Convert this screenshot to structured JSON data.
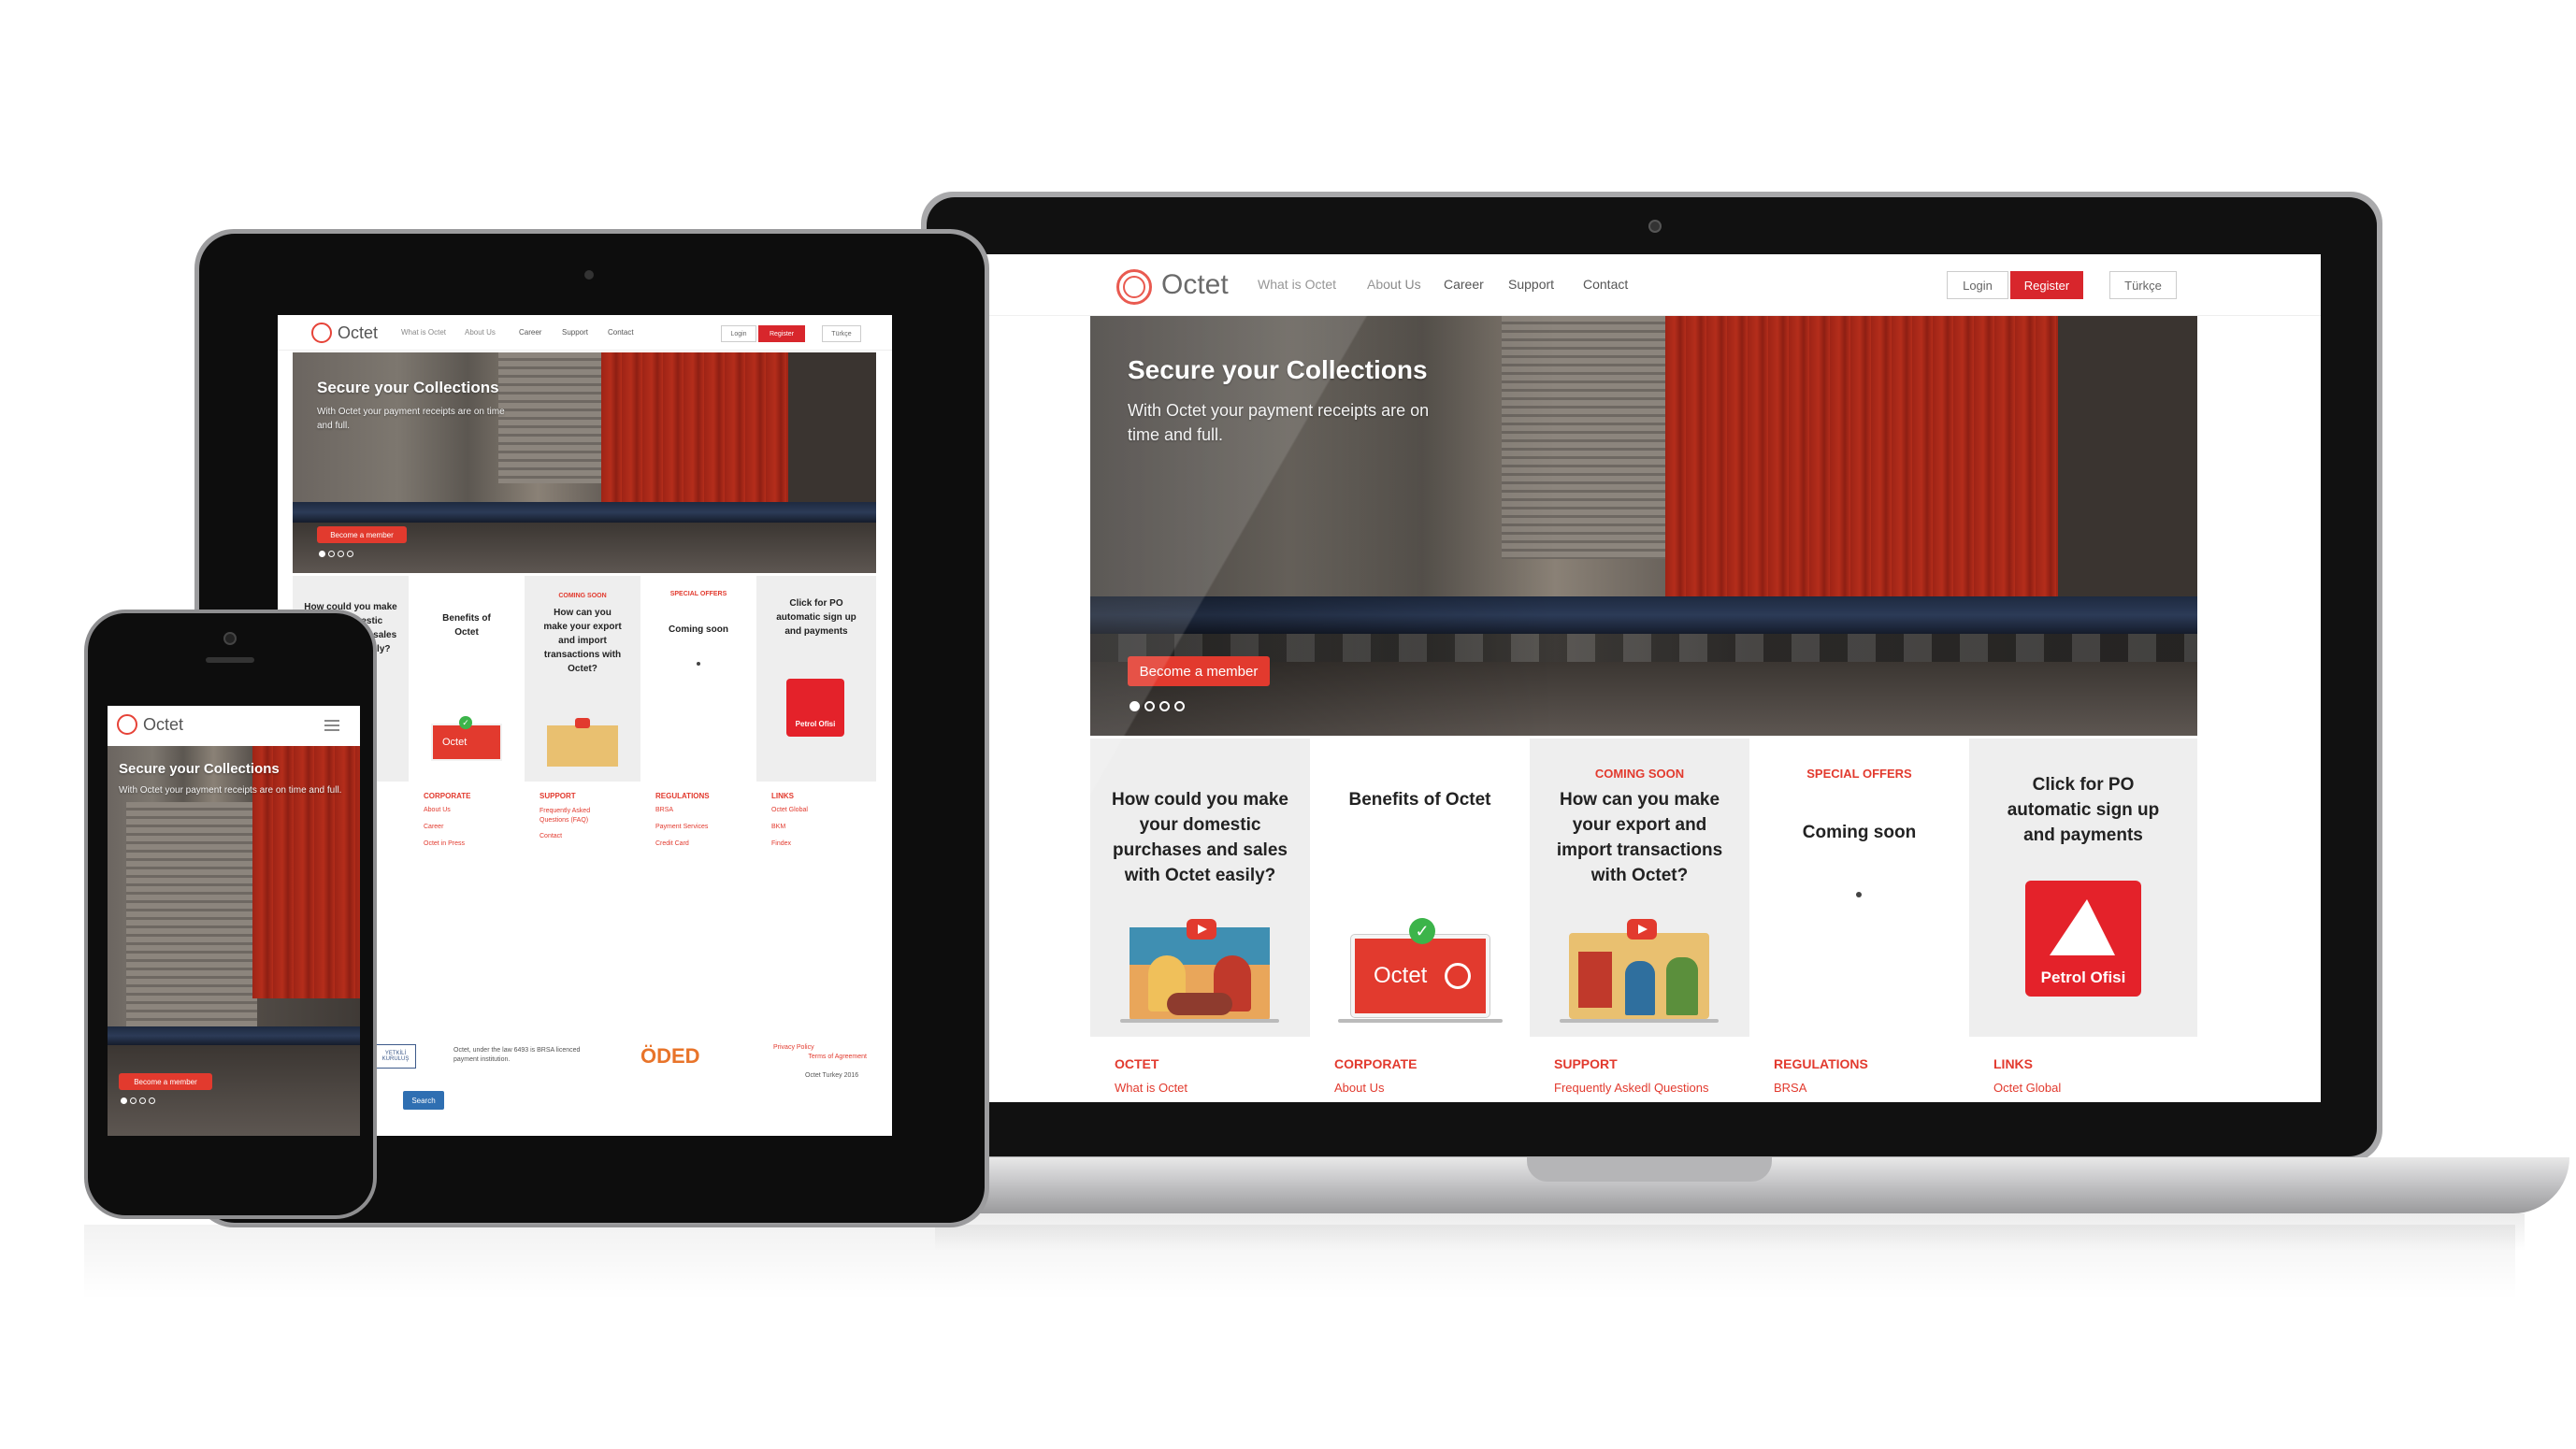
{
  "brand": {
    "name": "Octet",
    "accent": "#e23a2e"
  },
  "nav": {
    "items": [
      "What is Octet",
      "About Us",
      "Career",
      "Support",
      "Contact"
    ],
    "login": "Login",
    "register": "Register",
    "language": "Türkçe"
  },
  "hero": {
    "title": "Secure your Collections",
    "subtitle": "With Octet your payment receipts are on time and full.",
    "cta": "Become a member",
    "slides": 4,
    "active_slide": 1
  },
  "cards": [
    {
      "tag": "",
      "title": "How could you make your domestic purchases and sales with Octet easily?"
    },
    {
      "tag": "",
      "title": "Benefits of Octet"
    },
    {
      "tag": "COMING SOON",
      "title": "How can you make your export and import transactions with Octet?"
    },
    {
      "tag": "SPECIAL OFFERS",
      "title": "Coming soon"
    },
    {
      "tag": "",
      "title": "Click for PO automatic sign up and payments"
    }
  ],
  "petrol_ofisi": "Petrol Ofisi",
  "footer": {
    "octet": {
      "heading": "OCTET",
      "links": [
        "What is Octet"
      ]
    },
    "corporate": {
      "heading": "CORPORATE",
      "links": [
        "About Us",
        "Career",
        "Octet in Press"
      ]
    },
    "support": {
      "heading": "SUPPORT",
      "links": [
        "Frequently Askedl Questions",
        "Frequently Asked Questions (FAQ)",
        "Contact"
      ]
    },
    "regulations": {
      "heading": "REGULATIONS",
      "links": [
        "BRSA",
        "Payment Services",
        "Credit Card"
      ]
    },
    "links": {
      "heading": "LINKS",
      "links": [
        "Octet Global",
        "BKM",
        "Findex"
      ]
    },
    "legal": "Octet, under the law 6493 is BRSA licenced payment institution.",
    "privacy": "Privacy Policy",
    "terms": "Terms of Agreement",
    "copyright": "Octet Turkey 2016",
    "search": "Search",
    "oded": "ÖDED",
    "yetkili": "YETKİLİ KURULUŞ"
  }
}
